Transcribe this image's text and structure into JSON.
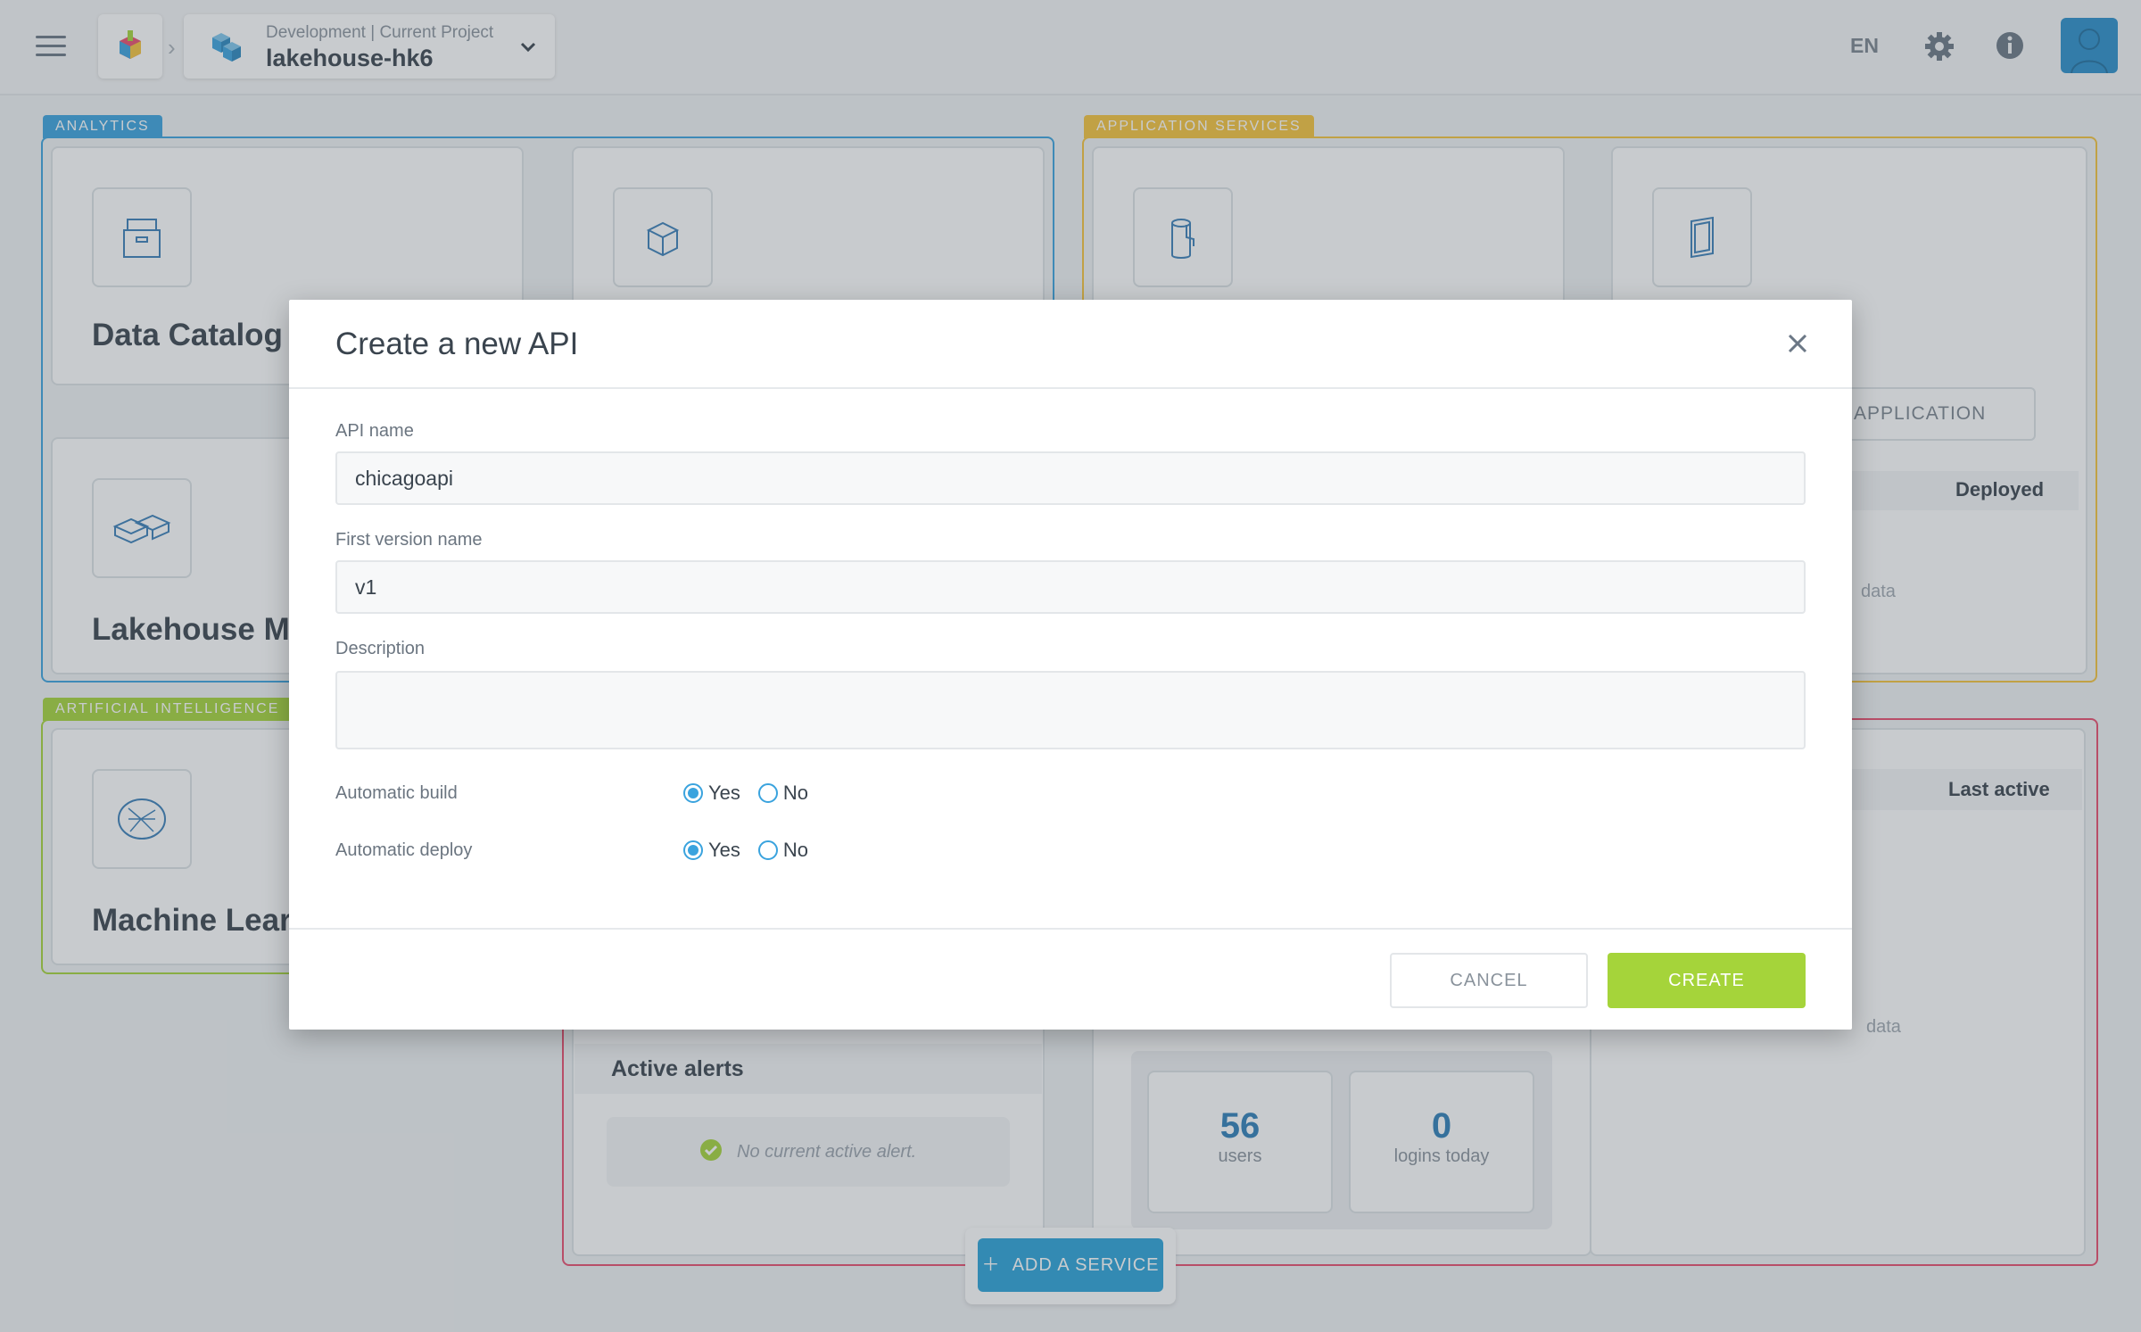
{
  "header": {
    "project_context": "Development | Current Project",
    "project_name": "lakehouse-hk6",
    "language": "EN"
  },
  "groups": {
    "analytics": "ANALYTICS",
    "application_services": "APPLICATION SERVICES",
    "artificial_intelligence": "ARTIFICIAL INTELLIGENCE"
  },
  "cards": {
    "data_catalog": "Data Catalog",
    "lakehouse": "Lakehouse Mar",
    "machine_learning": "Machine Learni"
  },
  "app_services": {
    "application_button": "APPLICATION",
    "deployed_label": "Deployed",
    "no_data_1": "data",
    "last_active_label": "Last active",
    "no_data_2": "data"
  },
  "alerts": {
    "title": "Active alerts",
    "empty": "No current active alert."
  },
  "stats": [
    {
      "value": "56",
      "label": "users"
    },
    {
      "value": "0",
      "label": "logins today"
    }
  ],
  "add_service": {
    "label": "ADD A SERVICE"
  },
  "modal": {
    "title": "Create a new API",
    "api_name_label": "API name",
    "api_name_value": "chicagoapi",
    "version_label": "First version name",
    "version_value": "v1",
    "description_label": "Description",
    "description_value": "",
    "auto_build_label": "Automatic build",
    "auto_deploy_label": "Automatic deploy",
    "yes": "Yes",
    "no": "No",
    "cancel": "CANCEL",
    "create": "CREATE"
  },
  "colors": {
    "analytics": "#3aa3de",
    "application_services": "#f5c33b",
    "artificial_intelligence": "#a5d43a",
    "monitoring": "#e84d6e",
    "create_button": "#a5d43a"
  }
}
